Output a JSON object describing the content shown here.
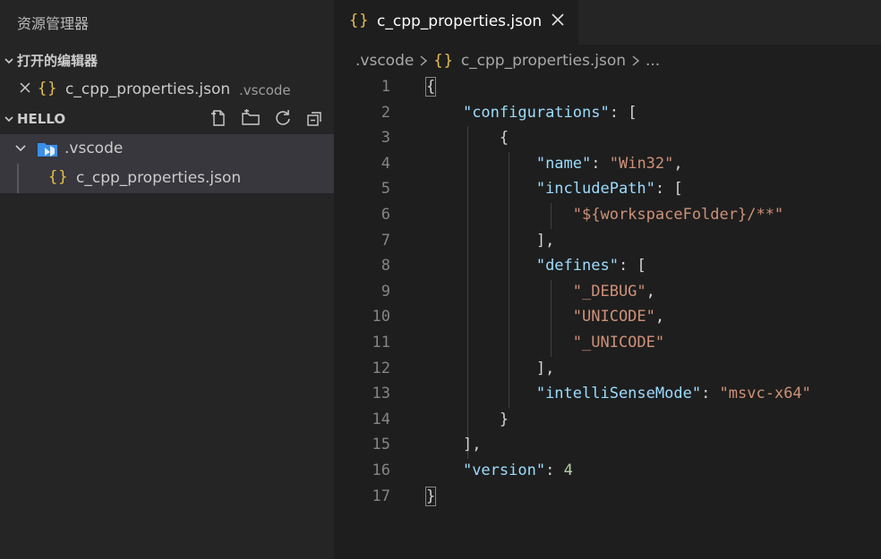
{
  "sidebar": {
    "title": "资源管理器",
    "open_editors": {
      "header": "打开的编辑器",
      "items": [
        {
          "name": "c_cpp_properties.json",
          "dir": ".vscode"
        }
      ]
    },
    "workspace": {
      "header": "HELLO",
      "folder": ".vscode",
      "file": "c_cpp_properties.json"
    }
  },
  "editor": {
    "tab_label": "c_cpp_properties.json",
    "breadcrumb": {
      "folder": ".vscode",
      "file": "c_cpp_properties.json",
      "more": "..."
    },
    "lines": [
      {
        "num": "1"
      },
      {
        "num": "2"
      },
      {
        "num": "3"
      },
      {
        "num": "4"
      },
      {
        "num": "5"
      },
      {
        "num": "6"
      },
      {
        "num": "7"
      },
      {
        "num": "8"
      },
      {
        "num": "9"
      },
      {
        "num": "10"
      },
      {
        "num": "11"
      },
      {
        "num": "12"
      },
      {
        "num": "13"
      },
      {
        "num": "14"
      },
      {
        "num": "15"
      },
      {
        "num": "16"
      },
      {
        "num": "17"
      }
    ],
    "code": {
      "l1_open": "{",
      "k_configurations": "\"configurations\"",
      "l2_rest": ": [",
      "l3_open": "{",
      "k_name": "\"name\"",
      "v_name": "\"Win32\"",
      "k_includePath": "\"includePath\"",
      "l5_rest": ": [",
      "v_include": "\"${workspaceFolder}/**\"",
      "l7_close": "],",
      "k_defines": "\"defines\"",
      "l8_rest": ": [",
      "v_debug": "\"_DEBUG\"",
      "v_unicode": "\"UNICODE\"",
      "v_unicode2": "\"_UNICODE\"",
      "l12_close": "],",
      "k_intelli": "\"intelliSenseMode\"",
      "v_intelli": "\"msvc-x64\"",
      "l14_close": "}",
      "l15_close": "],",
      "k_version": "\"version\"",
      "v_version": "4",
      "l17_close": "}"
    }
  },
  "colors": {
    "sidebar_bg": "#252526",
    "editor_bg": "#1e1e1e",
    "selected_row": "#37373d",
    "json_key": "#9cdcfe",
    "json_string": "#ce9178",
    "json_number": "#b5cea8",
    "braces_icon": "#e8c14a",
    "folder_icon": "#3b8eea"
  }
}
